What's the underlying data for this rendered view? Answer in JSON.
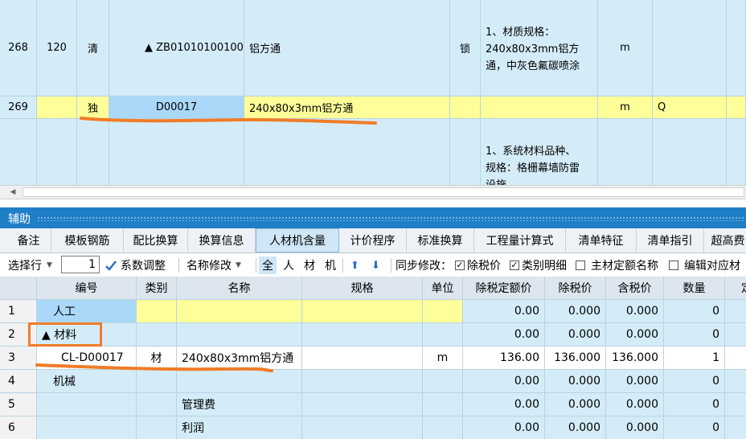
{
  "top_grid": {
    "rows": [
      {
        "rownum": "268",
        "seq": "120",
        "category": "清",
        "code": "▲ ZB01010100100",
        "name": "铝方通",
        "lock": "锁",
        "feature_lines": [
          "1、材质规格：",
          "240x80x3mm铝方",
          "通，中灰色氟碳喷涂"
        ],
        "unit": "m",
        "extra": ""
      },
      {
        "rownum": "269",
        "seq": "",
        "category": "独",
        "code": "D00017",
        "name": "240x80x3mm铝方通",
        "lock": "",
        "feature_lines": [],
        "unit": "m",
        "extra": "Q"
      },
      {
        "rownum": "",
        "seq": "",
        "category": "",
        "code": "",
        "name": "",
        "lock": "",
        "feature_lines": [
          "1、系统材料品种、",
          "规格：格栅幕墙防雷",
          "设施"
        ],
        "unit": "",
        "extra": ""
      }
    ]
  },
  "aux": {
    "title": "辅助"
  },
  "tabs": [
    "备注",
    "模板钢筋",
    "配比换算",
    "换算信息",
    "人材机含量",
    "计价程序",
    "标准换算",
    "工程量计算式",
    "清单特征",
    "清单指引",
    "超高费"
  ],
  "active_tab": 4,
  "toolbar": {
    "select_row": "选择行",
    "row_value": "1",
    "coef_adjust": "系数调整",
    "name_modify": "名称修改",
    "filter_all": "全",
    "filter_labor": "人",
    "filter_material": "材",
    "filter_machine": "机",
    "sync_label": "同步修改：",
    "chk_tax_excl": "除税价",
    "chk_category_detail": "类别明细",
    "chk_main_material": "主材定额名称",
    "chk_edit_corresponding": "编辑对应材"
  },
  "bottom_grid": {
    "headers": [
      "",
      "编号",
      "类别",
      "名称",
      "规格",
      "单位",
      "除税定额价",
      "除税价",
      "含税价",
      "数量",
      "定"
    ],
    "rows": [
      {
        "rownum": "1",
        "code": "人工",
        "category": "",
        "name": "",
        "spec": "",
        "unit": "",
        "quota_price": "0.00",
        "price_excl": "0.000",
        "price_incl": "0.000",
        "qty": "0"
      },
      {
        "rownum": "2",
        "code": "▲ 材料",
        "category": "",
        "name": "",
        "spec": "",
        "unit": "",
        "quota_price": "0.00",
        "price_excl": "0.000",
        "price_incl": "0.000",
        "qty": "0"
      },
      {
        "rownum": "3",
        "code": "CL-D00017",
        "category": "材",
        "name": "240x80x3mm铝方通",
        "spec": "",
        "unit": "m",
        "quota_price": "136.00",
        "price_excl": "136.000",
        "price_incl": "136.000",
        "qty": "1"
      },
      {
        "rownum": "4",
        "code": "机械",
        "category": "",
        "name": "",
        "spec": "",
        "unit": "",
        "quota_price": "0.00",
        "price_excl": "0.000",
        "price_incl": "0.000",
        "qty": "0"
      },
      {
        "rownum": "5",
        "code": "",
        "category": "",
        "name": "管理费",
        "spec": "",
        "unit": "",
        "quota_price": "0.00",
        "price_excl": "0.000",
        "price_incl": "0.000",
        "qty": "0"
      },
      {
        "rownum": "6",
        "code": "",
        "category": "",
        "name": "利润",
        "spec": "",
        "unit": "",
        "quota_price": "0.00",
        "price_excl": "0.000",
        "price_incl": "0.000",
        "qty": "0"
      }
    ]
  },
  "colors": {
    "accent": "#1f7fc6",
    "highlight_yellow": "#ffff99",
    "grid_blue": "#d4ecf8",
    "annotation_orange": "#f07c28"
  }
}
